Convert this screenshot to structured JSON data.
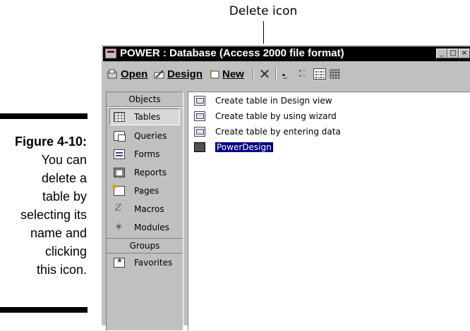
{
  "callout": {
    "label": "Delete icon"
  },
  "figure": {
    "number": "Figure 4-10:",
    "caption_lines": [
      "You can",
      "delete a",
      "table by",
      "selecting its",
      "name and",
      "clicking",
      "this icon."
    ]
  },
  "window": {
    "title": "POWER : Database (Access 2000 file format)",
    "controls": {
      "minimize": "_",
      "maximize": "□",
      "close": "×"
    }
  },
  "toolbar": {
    "open_label": "Open",
    "design_label": "Design",
    "new_label": "New",
    "delete_symbol": "✕"
  },
  "objects": {
    "header": "Objects",
    "items": [
      {
        "label": "Tables",
        "icon": "table-icon"
      },
      {
        "label": "Queries",
        "icon": "query-icon"
      },
      {
        "label": "Forms",
        "icon": "form-icon"
      },
      {
        "label": "Reports",
        "icon": "report-icon"
      },
      {
        "label": "Pages",
        "icon": "page-icon"
      },
      {
        "label": "Macros",
        "icon": "macro-icon"
      },
      {
        "label": "Modules",
        "icon": "module-icon"
      }
    ],
    "groups_header": "Groups",
    "groups": [
      {
        "label": "Favorites",
        "icon": "favorites-icon"
      }
    ]
  },
  "list": {
    "items": [
      {
        "label": "Create table in Design view",
        "icon": "wizard-icon"
      },
      {
        "label": "Create table by using wizard",
        "icon": "wizard-icon"
      },
      {
        "label": "Create table by entering data",
        "icon": "wizard-icon"
      },
      {
        "label": "PowerDesign",
        "icon": "table-icon"
      }
    ],
    "selected_item": "PowerDesign"
  },
  "colors": {
    "titlebar": "#000000",
    "window_face": "#c0c0c0",
    "selection": "#000080"
  }
}
